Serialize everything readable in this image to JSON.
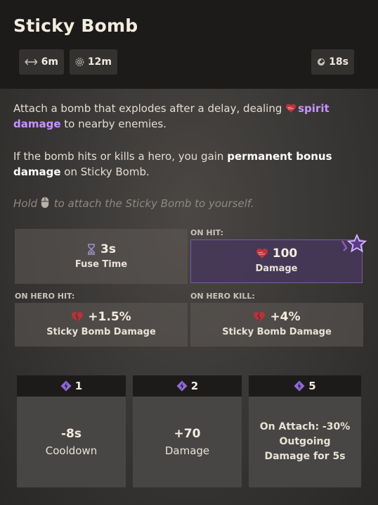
{
  "ability": {
    "title": "Sticky Bomb",
    "stats": {
      "range": "6m",
      "radius": "12m",
      "cooldown": "18s"
    }
  },
  "description": {
    "line1_pre": "Attach a bomb that explodes after a delay, dealing ",
    "line1_spirit": "spirit damage",
    "line1_post": " to nearby enemies.",
    "line2_pre": "If the bomb hits or kills a hero, you gain ",
    "line2_bold": "permanent bonus damage",
    "line2_post": " on Sticky Bomb.",
    "hint_pre": "Hold",
    "hint_post": "to attach the Sticky Bomb to yourself."
  },
  "properties": {
    "fuse_time": {
      "value": "3s",
      "label": "Fuse Time"
    },
    "on_hit": {
      "header": "ON HIT:",
      "value": "100",
      "label": "Damage"
    },
    "on_hero_hit": {
      "header": "ON HERO HIT:",
      "value": "+1.5%",
      "label": "Sticky Bomb Damage"
    },
    "on_hero_kill": {
      "header": "ON HERO KILL:",
      "value": "+4%",
      "label": "Sticky Bomb Damage"
    }
  },
  "upgrades": [
    {
      "cost": "1",
      "value": "-8s",
      "label": "Cooldown"
    },
    {
      "cost": "2",
      "value": "+70",
      "label": "Damage"
    },
    {
      "cost": "5",
      "text": "On Attach: -30% Outgoing Damage for 5s"
    }
  ],
  "colors": {
    "spirit": "#c792ff",
    "heart": "#c0323a",
    "accent_border": "#7b5aa6"
  }
}
